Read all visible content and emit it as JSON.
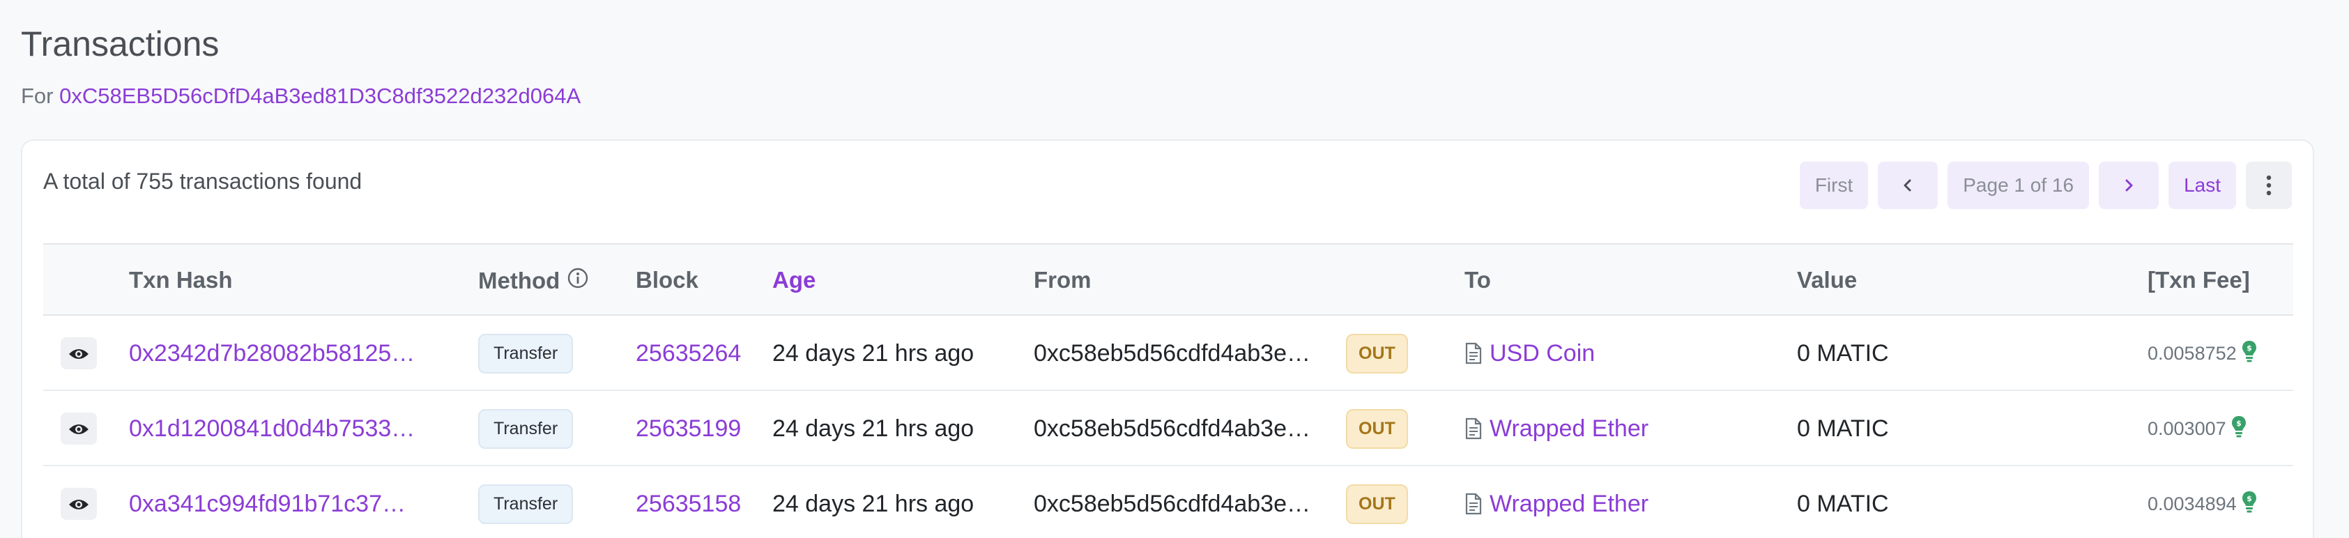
{
  "page": {
    "title": "Transactions",
    "for_label": "For",
    "address": "0xC58EB5D56cDfD4aB3ed81D3C8df3522d232d064A"
  },
  "summary": {
    "total_text": "A total of 755 transactions found"
  },
  "pagination": {
    "first": "First",
    "page_info": "Page 1 of 16",
    "last": "Last",
    "prev_icon": "chevron-left-icon",
    "next_icon": "chevron-right-icon",
    "more_icon": "vertical-dots-icon"
  },
  "columns": {
    "txn_hash": "Txn Hash",
    "method": "Method",
    "block": "Block",
    "age": "Age",
    "from": "From",
    "to": "To",
    "value": "Value",
    "fee": "[Txn Fee]"
  },
  "colors": {
    "accent": "#8b3cd6",
    "out_badge_bg": "#fbeccd",
    "out_badge_text": "#a3761a",
    "method_badge_bg": "#ebf3fb",
    "fee_icon": "#38a169"
  },
  "rows": [
    {
      "hash": "0x2342d7b28082b58125…",
      "method": "Transfer",
      "block": "25635264",
      "age": "24 days 21 hrs ago",
      "from": "0xc58eb5d56cdfd4ab3e…",
      "direction": "OUT",
      "to": "USD Coin",
      "value": "0 MATIC",
      "fee": "0.0058752"
    },
    {
      "hash": "0x1d1200841d0d4b7533…",
      "method": "Transfer",
      "block": "25635199",
      "age": "24 days 21 hrs ago",
      "from": "0xc58eb5d56cdfd4ab3e…",
      "direction": "OUT",
      "to": "Wrapped Ether",
      "value": "0 MATIC",
      "fee": "0.003007"
    },
    {
      "hash": "0xa341c994fd91b71c37…",
      "method": "Transfer",
      "block": "25635158",
      "age": "24 days 21 hrs ago",
      "from": "0xc58eb5d56cdfd4ab3e…",
      "direction": "OUT",
      "to": "Wrapped Ether",
      "value": "0 MATIC",
      "fee": "0.0034894"
    }
  ]
}
